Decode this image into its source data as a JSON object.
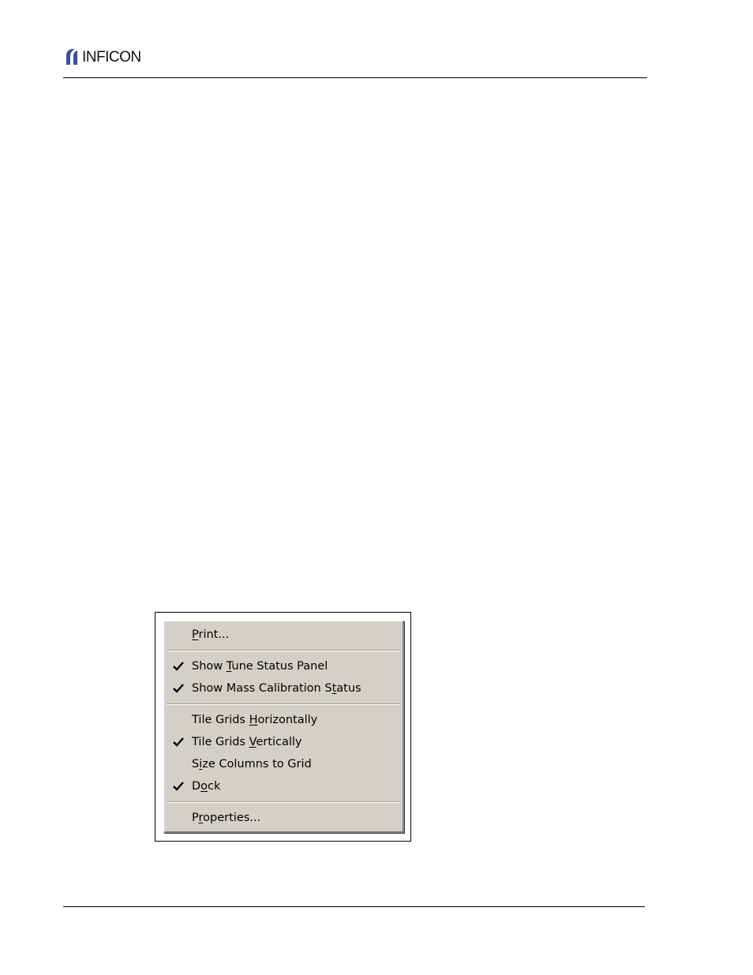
{
  "header": {
    "brand": "INFICON",
    "brand_color": "#3a4fa0"
  },
  "menu": {
    "items": [
      {
        "label": "Print...",
        "checked": false,
        "mnemonic_index": 0
      },
      {
        "separator": true
      },
      {
        "label": "Show Tune Status Panel",
        "checked": true,
        "mnemonic_index": 5
      },
      {
        "label": "Show Mass Calibration Status",
        "checked": true,
        "mnemonic_index": 23
      },
      {
        "separator": true
      },
      {
        "label": "Tile Grids Horizontally",
        "checked": false,
        "mnemonic_index": 11
      },
      {
        "label": "Tile Grids Vertically",
        "checked": true,
        "mnemonic_index": 11
      },
      {
        "label": "Size Columns to Grid",
        "checked": false,
        "mnemonic_index": 1
      },
      {
        "label": "Dock",
        "checked": true,
        "mnemonic_index": 1
      },
      {
        "separator": true
      },
      {
        "label": "Properties...",
        "checked": false,
        "mnemonic_index": 1
      }
    ],
    "check_icon": "checkmark-icon",
    "background_color": "#d4d0c8"
  }
}
